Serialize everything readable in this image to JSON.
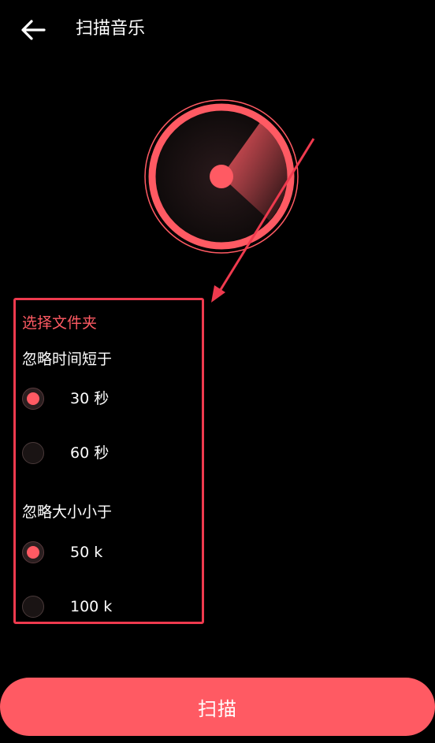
{
  "header": {
    "back_icon": "arrow-left-icon",
    "title": "扫描音乐"
  },
  "radar": {
    "icon": "radar-icon",
    "accent": "#ff5a63"
  },
  "settings": {
    "folder_link": "选择文件夹",
    "duration_group": {
      "title": "忽略时间短于",
      "options": [
        {
          "label": "30 秒",
          "selected": true
        },
        {
          "label": "60 秒",
          "selected": false
        }
      ]
    },
    "size_group": {
      "title": "忽略大小小于",
      "options": [
        {
          "label": "50 k",
          "selected": true
        },
        {
          "label": "100 k",
          "selected": false
        }
      ]
    }
  },
  "scan_button": {
    "label": "扫描"
  },
  "colors": {
    "background": "#000000",
    "accent": "#ff5a63",
    "annotation": "#ef3a4e"
  }
}
